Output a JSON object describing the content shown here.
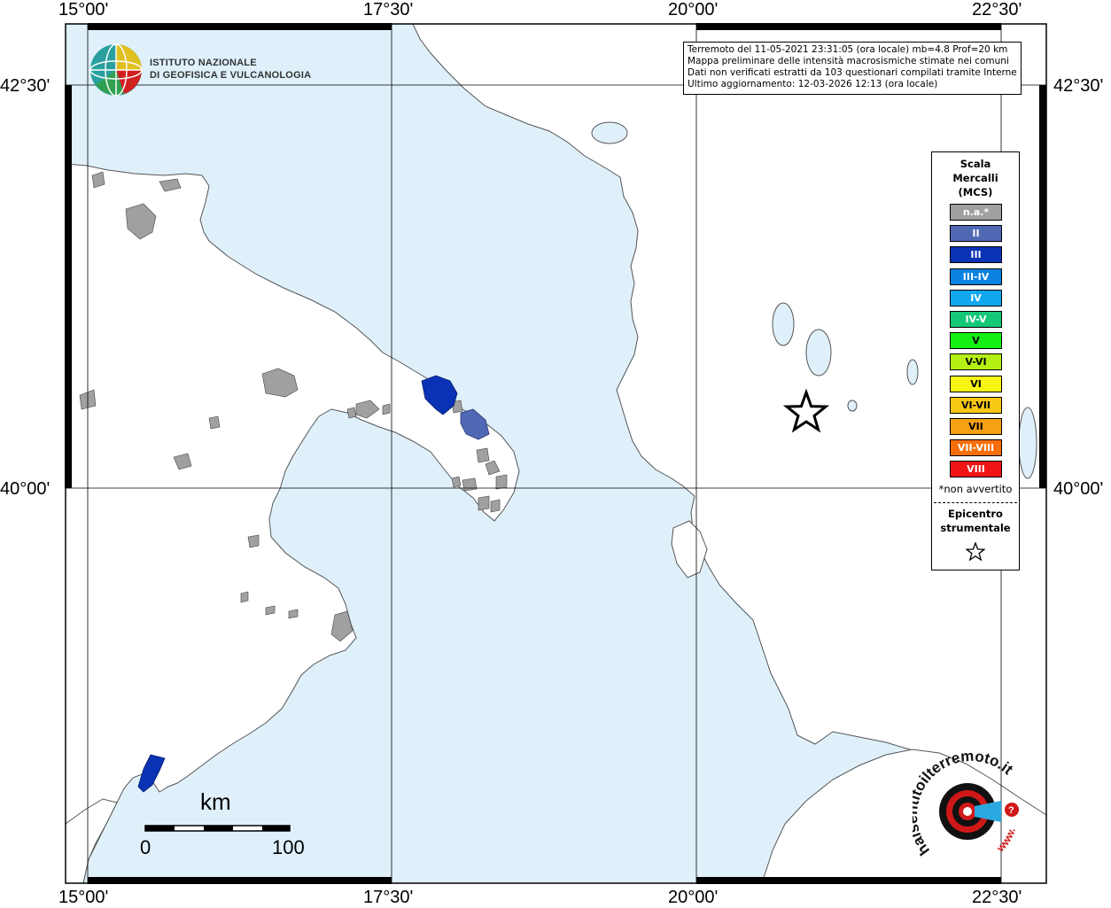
{
  "map": {
    "sea_color": "#dff0fb",
    "land_color": "#ffffff",
    "grid_color": "#000000",
    "lon_ticks": [
      "15°00'",
      "17°30'",
      "20°00'",
      "22°30'"
    ],
    "lat_ticks": [
      "42°30'",
      "40°00'"
    ],
    "epicenter_marker": "star-icon"
  },
  "institute": {
    "line1": "ISTITUTO NAZIONALE",
    "line2": "DI GEOFISICA E VULCANOLOGIA"
  },
  "info": {
    "line1": "Terremoto del 11-05-2021 23:31:05 (ora locale) mb=4.8 Prof=20 km",
    "line2": "Mappa preliminare delle intensità macrosismiche stimate nei comuni",
    "line3": "Dati non verificati estratti da 103 questionari compilati tramite Internet.",
    "line4": "Ultimo aggiornamento: 12-03-2026 12:13 (ora locale)"
  },
  "legend": {
    "title1": "Scala",
    "title2": "Mercalli",
    "title3": "(MCS)",
    "items": [
      {
        "label": "n.a.*",
        "color": "#a0a0a0"
      },
      {
        "label": "II",
        "color": "#5068b4"
      },
      {
        "label": "III",
        "color": "#0a32b4"
      },
      {
        "label": "III-IV",
        "color": "#0a82e0"
      },
      {
        "label": "IV",
        "color": "#12a8f0"
      },
      {
        "label": "IV-V",
        "color": "#14c878"
      },
      {
        "label": "V",
        "color": "#14f014"
      },
      {
        "label": "V-VI",
        "color": "#b4f014"
      },
      {
        "label": "VI",
        "color": "#f8f414"
      },
      {
        "label": "VI-VII",
        "color": "#f8c814"
      },
      {
        "label": "VII",
        "color": "#f8a014"
      },
      {
        "label": "VII-VIII",
        "color": "#f86e0a"
      },
      {
        "label": "VIII",
        "color": "#f01414"
      }
    ],
    "note": "*non avvertito",
    "epi1": "Epicentro",
    "epi2": "strumentale"
  },
  "scale": {
    "unit": "km",
    "min": "0",
    "max": "100"
  },
  "badge": {
    "text": "haisentitoilterremoto.it",
    "url_text": "www."
  }
}
